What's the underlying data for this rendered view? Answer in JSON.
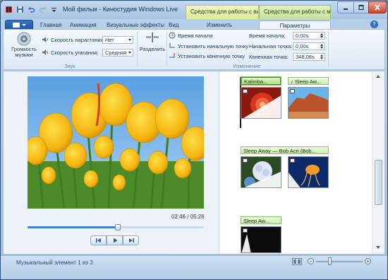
{
  "window": {
    "title": "Мой фильм - Киностудия Windows Live",
    "context_tabs": [
      "Средства для работы с видео",
      "Средства для работы с музыкой"
    ]
  },
  "tabs": [
    {
      "label": "Главная"
    },
    {
      "label": "Анимация"
    },
    {
      "label": "Визуальные эффекты"
    },
    {
      "label": "Вид"
    },
    {
      "label": "Изменить"
    },
    {
      "label": "Параметры",
      "active": true
    }
  ],
  "ribbon": {
    "volume_label": "Громкость музыки",
    "fade_in_label": "Скорость нарастания:",
    "fade_in_value": "Нет",
    "fade_out_label": "Скорость угасания:",
    "fade_out_value": "Средняя",
    "group_sound": "Звук",
    "split_label": "Разделить",
    "start_time_label": "Время начала",
    "set_start_point_label": "Установить начальную точку",
    "set_end_point_label": "Установить конечную точку",
    "start_time_field_label": "Время начала:",
    "start_time_value": "0,00s",
    "start_point_label": "Начальная точка:",
    "start_point_value": "0,00s",
    "end_point_label": "Конечная точка:",
    "end_point_value": "348,08s",
    "group_edit": "Изменение"
  },
  "preview": {
    "timecode": "02:46 / 05:26",
    "progress": 0.51
  },
  "storyboard": {
    "music_tags": [
      "Kalimba...",
      "Sleep Aw...",
      "Sleep Away — Bob Acri (Bob...",
      "Sleep Aw..."
    ]
  },
  "status": {
    "text": "Музыкальный элемент 1 из 3",
    "zoom_level": 0.3
  },
  "colors": {
    "accent": "#3b82d1",
    "music_tag": "#c9ecae",
    "context_video": "#d9ec95",
    "context_music": "#c3e39b"
  }
}
